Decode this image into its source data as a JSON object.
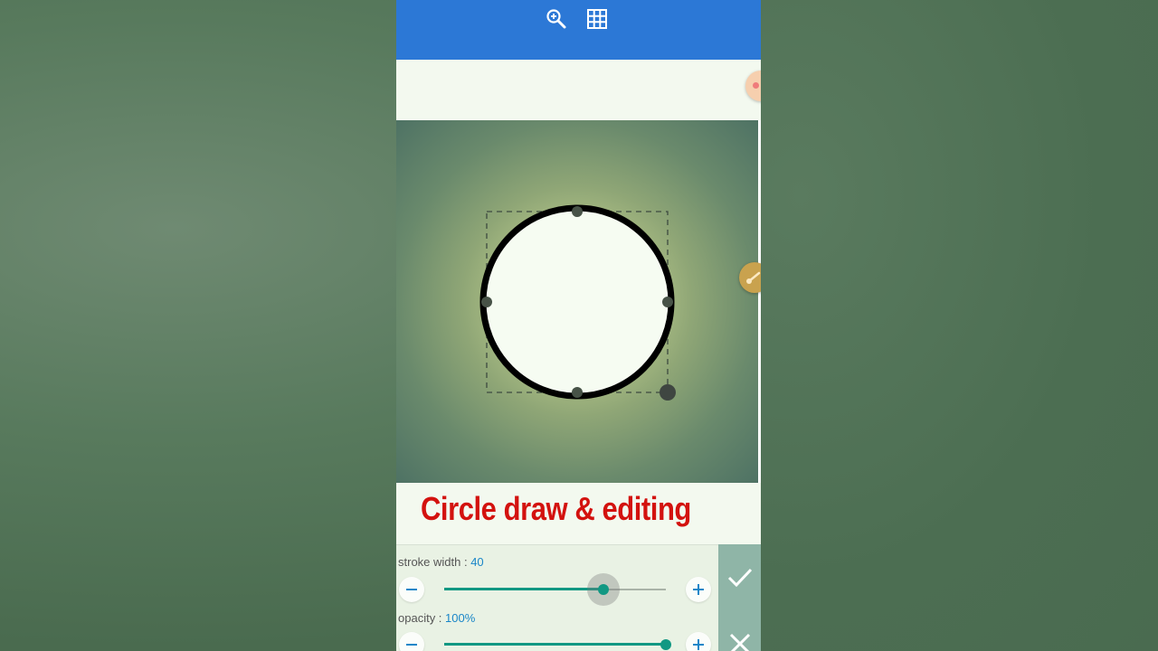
{
  "appbar": {
    "icons": [
      "zoom-in-icon",
      "grid-icon"
    ],
    "color": "#2c78d6"
  },
  "canvas": {
    "shape": "circle",
    "stroke_color": "#000000",
    "fill_color": "#f6fcf2"
  },
  "caption": {
    "text": "Circle draw & editing",
    "color": "#d3120f"
  },
  "controls": {
    "stroke_width": {
      "label": "stroke width : ",
      "value": "40",
      "level_percent": 72
    },
    "opacity": {
      "label": "opacity : ",
      "value": "100%",
      "level_percent": 100
    }
  },
  "actions": {
    "icons": [
      "check-icon",
      "close-icon"
    ]
  },
  "colors": {
    "accent": "#129883",
    "value_text": "#1a86c8"
  }
}
